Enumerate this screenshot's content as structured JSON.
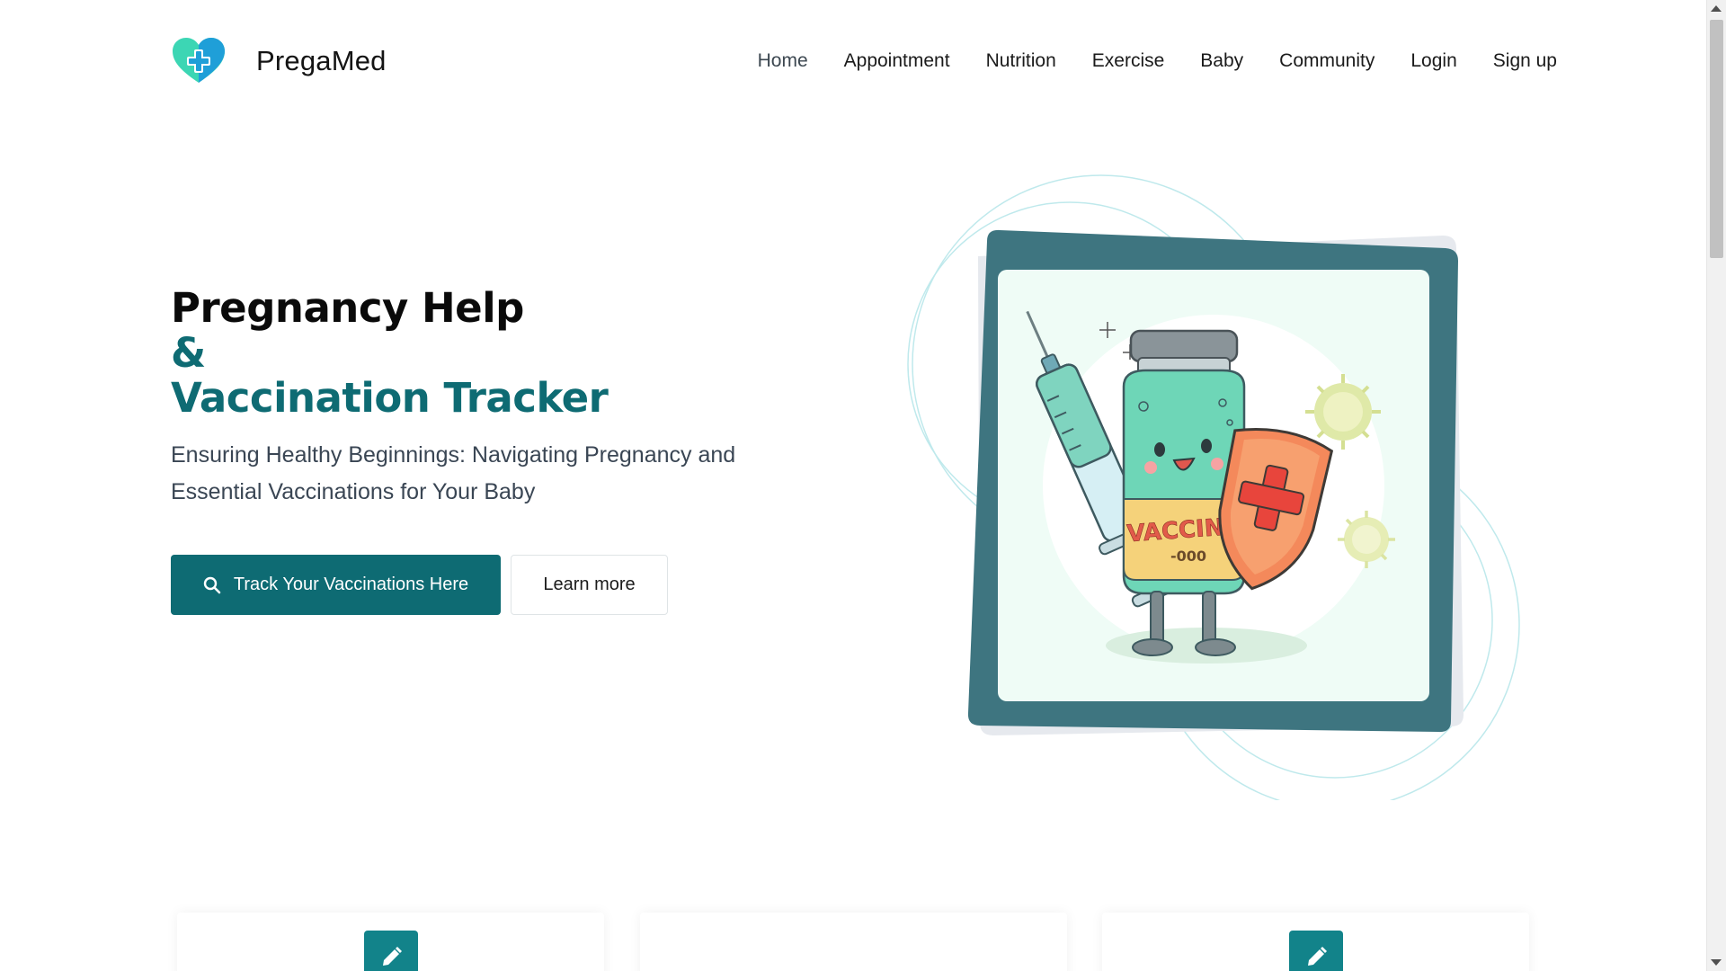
{
  "brand": {
    "name": "PregaMed",
    "logo_icon": "heart-plus-icon",
    "colors": {
      "teal": "#0e6b73",
      "heart_left": "#3cd6b4",
      "heart_right": "#1f9fd8"
    }
  },
  "nav": {
    "items": [
      {
        "label": "Home",
        "active": true
      },
      {
        "label": "Appointment"
      },
      {
        "label": "Nutrition"
      },
      {
        "label": "Exercise"
      },
      {
        "label": "Baby"
      },
      {
        "label": "Community"
      },
      {
        "label": "Login"
      },
      {
        "label": "Sign up"
      }
    ]
  },
  "hero": {
    "title_line1": "Pregnancy Help",
    "title_line2": "&",
    "title_line3": "Vaccination Tracker",
    "subtitle": "Ensuring Healthy Beginnings: Navigating Pregnancy and Essential Vaccinations for Your Baby",
    "primary_button": {
      "label": "Track Your Vaccinations Here",
      "icon": "search-icon"
    },
    "secondary_button": {
      "label": "Learn more"
    },
    "illustration": {
      "frame_color": "#3e7580",
      "background_color": "#effcf6",
      "bottle_label": "VACCINE",
      "bottle_sublabel": "-000"
    }
  },
  "features": {
    "cards": [
      {
        "icon": "pencil-icon"
      },
      {
        "icon": ""
      },
      {
        "icon": "pencil-icon"
      }
    ]
  }
}
